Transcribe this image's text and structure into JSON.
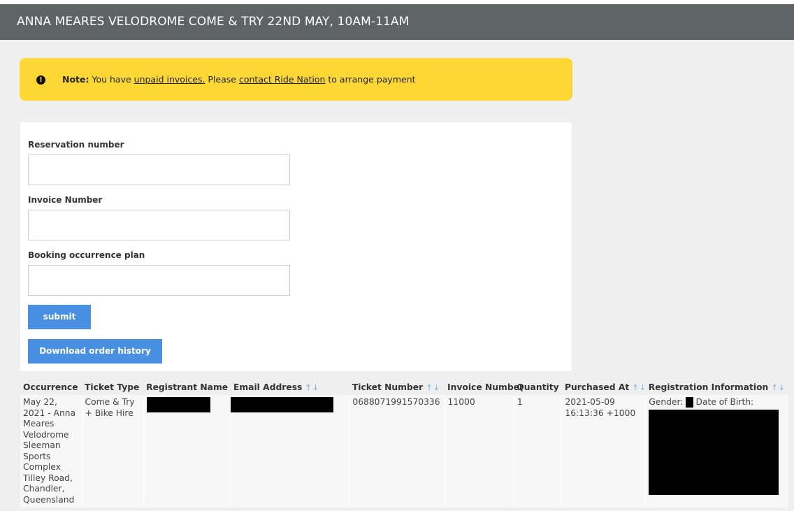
{
  "header": {
    "title": "ANNA MEARES VELODROME COME & TRY 22ND MAY, 10AM-11AM"
  },
  "alert": {
    "icon": "exclamation-circle-icon",
    "note_label": "Note:",
    "text1": " You have ",
    "link_invoices": "unpaid invoices.",
    "text2": " Please ",
    "link_contact": "contact Ride Nation",
    "text3": " to arrange payment"
  },
  "form": {
    "reservation_label": "Reservation number",
    "reservation_value": "",
    "invoice_label": "Invoice Number",
    "invoice_value": "",
    "occurrence_label": "Booking occurrence plan",
    "occurrence_value": "",
    "submit_label": "submit",
    "download_label": "Download order history"
  },
  "table": {
    "sort_glyph": "↑↓",
    "columns": {
      "occurrence": "Occurrence",
      "ticket_type": "Ticket Type",
      "registrant": "Registrant Name",
      "email": "Email Address",
      "ticket_number": "Ticket Number",
      "invoice_number": "Invoice Number",
      "quantity": "Quantity",
      "purchased_at": "Purchased At",
      "registration_info": "Registration Information"
    },
    "rows": [
      {
        "occurrence": "May 22, 2021 - Anna Meares Velodrome Sleeman Sports Complex Tilley Road, Chandler, Queensland",
        "ticket_type": "Come & Try + Bike Hire",
        "ticket_number": "0688071991570336",
        "invoice_number": "11000",
        "quantity": "1",
        "purchased_at": "2021-05-09 16:13:36 +1000",
        "gender_label": "Gender:",
        "dob_label": "Date of Birth:"
      }
    ]
  },
  "colors": {
    "header_bg": "#5e6366",
    "alert_bg": "#fdd835",
    "button_bg": "#4a90e2",
    "page_bg": "#efefef"
  }
}
